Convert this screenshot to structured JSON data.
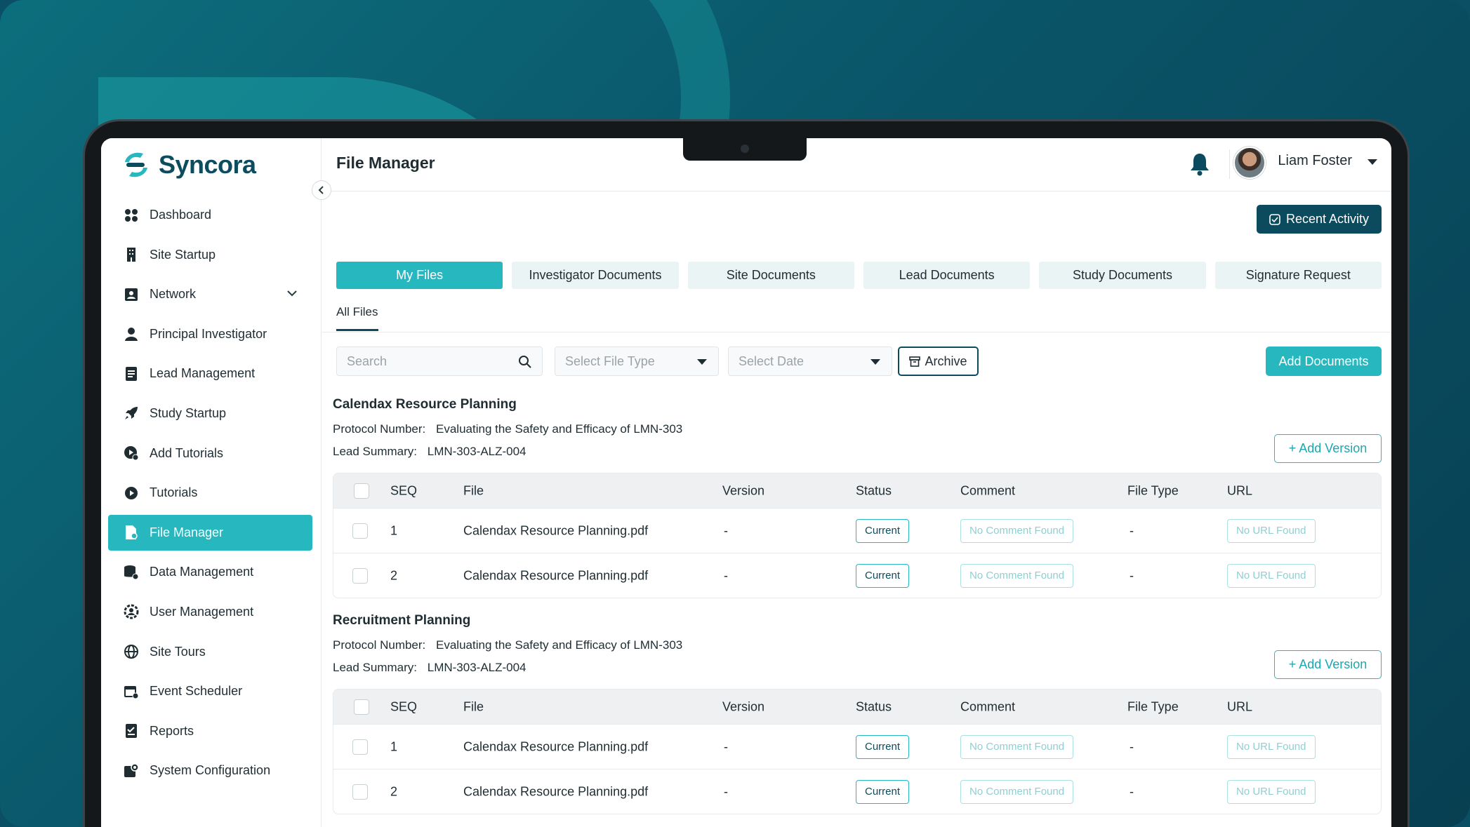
{
  "app": {
    "name": "Syncora"
  },
  "sidebar": {
    "items": [
      {
        "label": "Dashboard",
        "icon": "dashboard-icon"
      },
      {
        "label": "Site Startup",
        "icon": "building-icon"
      },
      {
        "label": "Network",
        "icon": "contact-card-icon"
      },
      {
        "label": "Principal Investigator",
        "icon": "user-icon"
      },
      {
        "label": "Lead Management",
        "icon": "document-icon"
      },
      {
        "label": "Study Startup",
        "icon": "rocket-icon"
      },
      {
        "label": "Add Tutorials",
        "icon": "video-add-icon"
      },
      {
        "label": "Tutorials",
        "icon": "play-icon"
      },
      {
        "label": "File Manager",
        "icon": "file-manager-icon"
      },
      {
        "label": "Data Management",
        "icon": "database-icon"
      },
      {
        "label": "User Management",
        "icon": "user-gear-icon"
      },
      {
        "label": "Site Tours",
        "icon": "globe-icon"
      },
      {
        "label": "Event Scheduler",
        "icon": "calendar-icon"
      },
      {
        "label": "Reports",
        "icon": "report-icon"
      },
      {
        "label": "System Configuration",
        "icon": "settings-icon"
      }
    ],
    "active": "File Manager"
  },
  "header": {
    "title": "File Manager",
    "user_name": "Liam Foster"
  },
  "actions": {
    "recent_activity": "Recent Activity",
    "add_documents": "Add Documents",
    "archive": "Archive",
    "add_version": "+ Add Version"
  },
  "tabs": [
    {
      "label": "My Files"
    },
    {
      "label": "Investigator Documents"
    },
    {
      "label": "Site Documents"
    },
    {
      "label": "Lead Documents"
    },
    {
      "label": "Study Documents"
    },
    {
      "label": "Signature Request"
    }
  ],
  "subtab": "All Files",
  "filters": {
    "search_placeholder": "Search",
    "file_type_placeholder": "Select File Type",
    "date_placeholder": "Select Date"
  },
  "table_headers": [
    "SEQ",
    "File",
    "Version",
    "Status",
    "Comment",
    "File Type",
    "URL"
  ],
  "sections": [
    {
      "title": "Calendax Resource Planning",
      "protocol_label": "Protocol Number:",
      "protocol_value": "Evaluating the Safety and Efficacy of LMN-303",
      "lead_label": "Lead Summary:",
      "lead_value": "LMN-303-ALZ-004",
      "rows": [
        {
          "seq": "1",
          "file": "Calendax Resource Planning.pdf",
          "version": "-",
          "status": "Current",
          "comment": "No Comment Found",
          "file_type": "-",
          "url": "No URL Found"
        },
        {
          "seq": "2",
          "file": "Calendax Resource Planning.pdf",
          "version": "-",
          "status": "Current",
          "comment": "No Comment Found",
          "file_type": "-",
          "url": "No URL Found"
        }
      ]
    },
    {
      "title": "Recruitment Planning",
      "protocol_label": "Protocol Number:",
      "protocol_value": "Evaluating the Safety and Efficacy of LMN-303",
      "lead_label": "Lead Summary:",
      "lead_value": "LMN-303-ALZ-004",
      "rows": [
        {
          "seq": "1",
          "file": "Calendax Resource Planning.pdf",
          "version": "-",
          "status": "Current",
          "comment": "No Comment Found",
          "file_type": "-",
          "url": "No URL Found"
        },
        {
          "seq": "2",
          "file": "Calendax Resource Planning.pdf",
          "version": "-",
          "status": "Current",
          "comment": "No Comment Found",
          "file_type": "-",
          "url": "No URL Found"
        }
      ]
    }
  ],
  "colors": {
    "accent": "#27b8bf",
    "dark": "#0c4b5d",
    "background": "#0a5468"
  }
}
